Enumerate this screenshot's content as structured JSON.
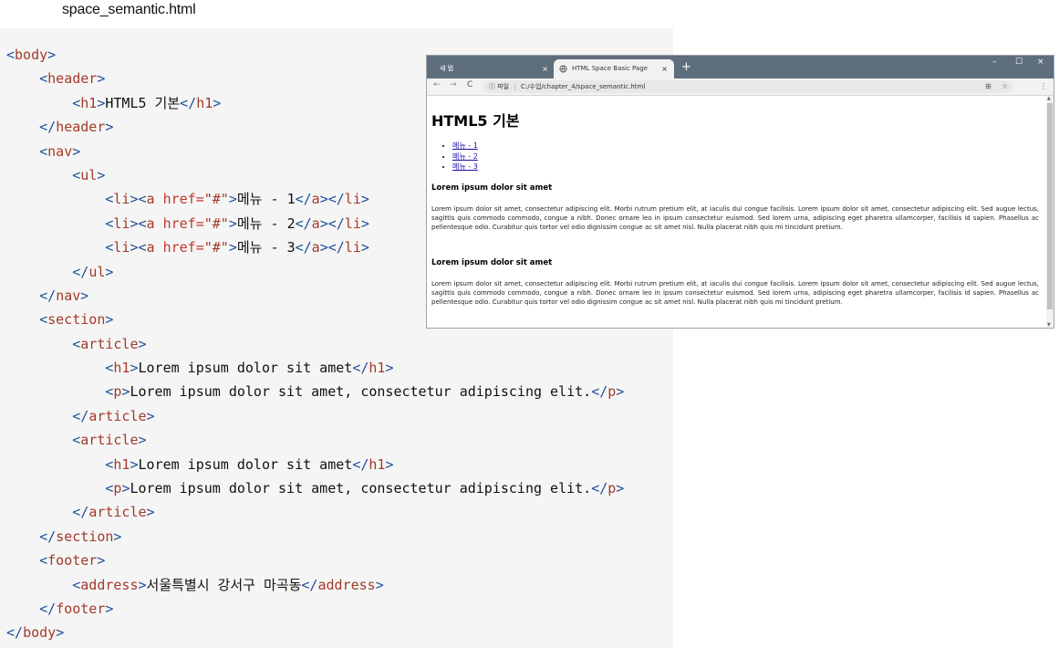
{
  "file_title": "space_semantic.html",
  "code_lines": [
    [
      {
        "c": "br",
        "t": "<"
      },
      {
        "c": "tg",
        "t": "body"
      },
      {
        "c": "br",
        "t": ">"
      }
    ],
    [
      {
        "c": "tx",
        "t": "    "
      },
      {
        "c": "br",
        "t": "<"
      },
      {
        "c": "tg",
        "t": "header"
      },
      {
        "c": "br",
        "t": ">"
      }
    ],
    [
      {
        "c": "tx",
        "t": "        "
      },
      {
        "c": "br",
        "t": "<"
      },
      {
        "c": "tg",
        "t": "h1"
      },
      {
        "c": "br",
        "t": ">"
      },
      {
        "c": "tx",
        "t": "HTML5 기본"
      },
      {
        "c": "br",
        "t": "</"
      },
      {
        "c": "tg",
        "t": "h1"
      },
      {
        "c": "br",
        "t": ">"
      }
    ],
    [
      {
        "c": "tx",
        "t": "    "
      },
      {
        "c": "br",
        "t": "</"
      },
      {
        "c": "tg",
        "t": "header"
      },
      {
        "c": "br",
        "t": ">"
      }
    ],
    [
      {
        "c": "tx",
        "t": "    "
      },
      {
        "c": "br",
        "t": "<"
      },
      {
        "c": "tg",
        "t": "nav"
      },
      {
        "c": "br",
        "t": ">"
      }
    ],
    [
      {
        "c": "tx",
        "t": "        "
      },
      {
        "c": "br",
        "t": "<"
      },
      {
        "c": "tg",
        "t": "ul"
      },
      {
        "c": "br",
        "t": ">"
      }
    ],
    [
      {
        "c": "tx",
        "t": "            "
      },
      {
        "c": "br",
        "t": "<"
      },
      {
        "c": "tg",
        "t": "li"
      },
      {
        "c": "br",
        "t": "><"
      },
      {
        "c": "tg",
        "t": "a "
      },
      {
        "c": "at",
        "t": "href="
      },
      {
        "c": "vl",
        "t": "\"#\""
      },
      {
        "c": "br",
        "t": ">"
      },
      {
        "c": "tx",
        "t": "메뉴 - 1"
      },
      {
        "c": "br",
        "t": "</"
      },
      {
        "c": "tg",
        "t": "a"
      },
      {
        "c": "br",
        "t": "></"
      },
      {
        "c": "tg",
        "t": "li"
      },
      {
        "c": "br",
        "t": ">"
      }
    ],
    [
      {
        "c": "tx",
        "t": "            "
      },
      {
        "c": "br",
        "t": "<"
      },
      {
        "c": "tg",
        "t": "li"
      },
      {
        "c": "br",
        "t": "><"
      },
      {
        "c": "tg",
        "t": "a "
      },
      {
        "c": "at",
        "t": "href="
      },
      {
        "c": "vl",
        "t": "\"#\""
      },
      {
        "c": "br",
        "t": ">"
      },
      {
        "c": "tx",
        "t": "메뉴 - 2"
      },
      {
        "c": "br",
        "t": "</"
      },
      {
        "c": "tg",
        "t": "a"
      },
      {
        "c": "br",
        "t": "></"
      },
      {
        "c": "tg",
        "t": "li"
      },
      {
        "c": "br",
        "t": ">"
      }
    ],
    [
      {
        "c": "tx",
        "t": "            "
      },
      {
        "c": "br",
        "t": "<"
      },
      {
        "c": "tg",
        "t": "li"
      },
      {
        "c": "br",
        "t": "><"
      },
      {
        "c": "tg",
        "t": "a "
      },
      {
        "c": "at",
        "t": "href="
      },
      {
        "c": "vl",
        "t": "\"#\""
      },
      {
        "c": "br",
        "t": ">"
      },
      {
        "c": "tx",
        "t": "메뉴 - 3"
      },
      {
        "c": "br",
        "t": "</"
      },
      {
        "c": "tg",
        "t": "a"
      },
      {
        "c": "br",
        "t": "></"
      },
      {
        "c": "tg",
        "t": "li"
      },
      {
        "c": "br",
        "t": ">"
      }
    ],
    [
      {
        "c": "tx",
        "t": "        "
      },
      {
        "c": "br",
        "t": "</"
      },
      {
        "c": "tg",
        "t": "ul"
      },
      {
        "c": "br",
        "t": ">"
      }
    ],
    [
      {
        "c": "tx",
        "t": "    "
      },
      {
        "c": "br",
        "t": "</"
      },
      {
        "c": "tg",
        "t": "nav"
      },
      {
        "c": "br",
        "t": ">"
      }
    ],
    [
      {
        "c": "tx",
        "t": "    "
      },
      {
        "c": "br",
        "t": "<"
      },
      {
        "c": "tg",
        "t": "section"
      },
      {
        "c": "br",
        "t": ">"
      }
    ],
    [
      {
        "c": "tx",
        "t": "        "
      },
      {
        "c": "br",
        "t": "<"
      },
      {
        "c": "tg",
        "t": "article"
      },
      {
        "c": "br",
        "t": ">"
      }
    ],
    [
      {
        "c": "tx",
        "t": "            "
      },
      {
        "c": "br",
        "t": "<"
      },
      {
        "c": "tg",
        "t": "h1"
      },
      {
        "c": "br",
        "t": ">"
      },
      {
        "c": "tx",
        "t": "Lorem ipsum dolor sit amet"
      },
      {
        "c": "br",
        "t": "</"
      },
      {
        "c": "tg",
        "t": "h1"
      },
      {
        "c": "br",
        "t": ">"
      }
    ],
    [
      {
        "c": "tx",
        "t": "            "
      },
      {
        "c": "br",
        "t": "<"
      },
      {
        "c": "tg",
        "t": "p"
      },
      {
        "c": "br",
        "t": ">"
      },
      {
        "c": "tx",
        "t": "Lorem ipsum dolor sit amet, consectetur adipiscing elit."
      },
      {
        "c": "br",
        "t": "</"
      },
      {
        "c": "tg",
        "t": "p"
      },
      {
        "c": "br",
        "t": ">"
      }
    ],
    [
      {
        "c": "tx",
        "t": "        "
      },
      {
        "c": "br",
        "t": "</"
      },
      {
        "c": "tg",
        "t": "article"
      },
      {
        "c": "br",
        "t": ">"
      }
    ],
    [
      {
        "c": "tx",
        "t": "        "
      },
      {
        "c": "br",
        "t": "<"
      },
      {
        "c": "tg",
        "t": "article"
      },
      {
        "c": "br",
        "t": ">"
      }
    ],
    [
      {
        "c": "tx",
        "t": "            "
      },
      {
        "c": "br",
        "t": "<"
      },
      {
        "c": "tg",
        "t": "h1"
      },
      {
        "c": "br",
        "t": ">"
      },
      {
        "c": "tx",
        "t": "Lorem ipsum dolor sit amet"
      },
      {
        "c": "br",
        "t": "</"
      },
      {
        "c": "tg",
        "t": "h1"
      },
      {
        "c": "br",
        "t": ">"
      }
    ],
    [
      {
        "c": "tx",
        "t": "            "
      },
      {
        "c": "br",
        "t": "<"
      },
      {
        "c": "tg",
        "t": "p"
      },
      {
        "c": "br",
        "t": ">"
      },
      {
        "c": "tx",
        "t": "Lorem ipsum dolor sit amet, consectetur adipiscing elit."
      },
      {
        "c": "br",
        "t": "</"
      },
      {
        "c": "tg",
        "t": "p"
      },
      {
        "c": "br",
        "t": ">"
      }
    ],
    [
      {
        "c": "tx",
        "t": "        "
      },
      {
        "c": "br",
        "t": "</"
      },
      {
        "c": "tg",
        "t": "article"
      },
      {
        "c": "br",
        "t": ">"
      }
    ],
    [
      {
        "c": "tx",
        "t": "    "
      },
      {
        "c": "br",
        "t": "</"
      },
      {
        "c": "tg",
        "t": "section"
      },
      {
        "c": "br",
        "t": ">"
      }
    ],
    [
      {
        "c": "tx",
        "t": "    "
      },
      {
        "c": "br",
        "t": "<"
      },
      {
        "c": "tg",
        "t": "footer"
      },
      {
        "c": "br",
        "t": ">"
      }
    ],
    [
      {
        "c": "tx",
        "t": "        "
      },
      {
        "c": "br",
        "t": "<"
      },
      {
        "c": "tg",
        "t": "address"
      },
      {
        "c": "br",
        "t": ">"
      },
      {
        "c": "tx",
        "t": "서울특별시 강서구 마곡동"
      },
      {
        "c": "br",
        "t": "</"
      },
      {
        "c": "tg",
        "t": "address"
      },
      {
        "c": "br",
        "t": ">"
      }
    ],
    [
      {
        "c": "tx",
        "t": "    "
      },
      {
        "c": "br",
        "t": "</"
      },
      {
        "c": "tg",
        "t": "footer"
      },
      {
        "c": "br",
        "t": ">"
      }
    ],
    [
      {
        "c": "br",
        "t": "</"
      },
      {
        "c": "tg",
        "t": "body"
      },
      {
        "c": "br",
        "t": ">"
      }
    ]
  ],
  "browser": {
    "tabs": [
      {
        "label": "새 탭",
        "close": "×"
      },
      {
        "label": "HTML Space Basic Page",
        "close": "×"
      }
    ],
    "new_tab": "+",
    "window_controls": {
      "minimize": "–",
      "maximize": "☐",
      "close": "×"
    },
    "nav": {
      "back": "←",
      "forward": "→",
      "reload": "C"
    },
    "address": {
      "info_icon": "ⓘ",
      "scheme_label": "파일",
      "separator": "|",
      "url": "C:/수업/chapter_4/space_semantic.html"
    },
    "toolbar_icons": {
      "translate": "⊞",
      "star": "☆",
      "menu": "⋮"
    },
    "page": {
      "heading": "HTML5 기본",
      "menu_items": [
        "메뉴 - 1",
        "메뉴 - 2",
        "메뉴 - 3"
      ],
      "articles": [
        {
          "title": "Lorem ipsum dolor sit amet",
          "body": "Lorem ipsum dolor sit amet, consectetur adipiscing elit. Morbi rutrum pretium elit, at iaculis dui congue facilisis. Lorem ipsum dolor sit amet, consectetur adipiscing elit. Sed augue lectus, sagittis quis commodo commodo, congue a nibh. Donec ornare leo in ipsum consectetur euismod. Sed lorem urna, adipiscing eget pharetra ullamcorper, facilisis id sapien. Phasellus ac pellentesque odio. Curabitur quis tortor vel odio dignissim congue ac sit amet nisl. Nulla placerat nibh quis mi tincidunt pretium."
        },
        {
          "title": "Lorem ipsum dolor sit amet",
          "body": "Lorem ipsum dolor sit amet, consectetur adipiscing elit. Morbi rutrum pretium elit, at iaculis dui congue facilisis. Lorem ipsum dolor sit amet, consectetur adipiscing elit. Sed augue lectus, sagittis quis commodo commodo, congue a nibh. Donec ornare leo in ipsum consectetur euismod. Sed lorem urna, adipiscing eget pharetra ullamcorper, facilisis id sapien. Phasellus ac pellentesque odio. Curabitur quis tortor vel odio dignissim congue ac sit amet nisl. Nulla placerat nibh quis mi tincidunt pretium."
        }
      ]
    }
  }
}
